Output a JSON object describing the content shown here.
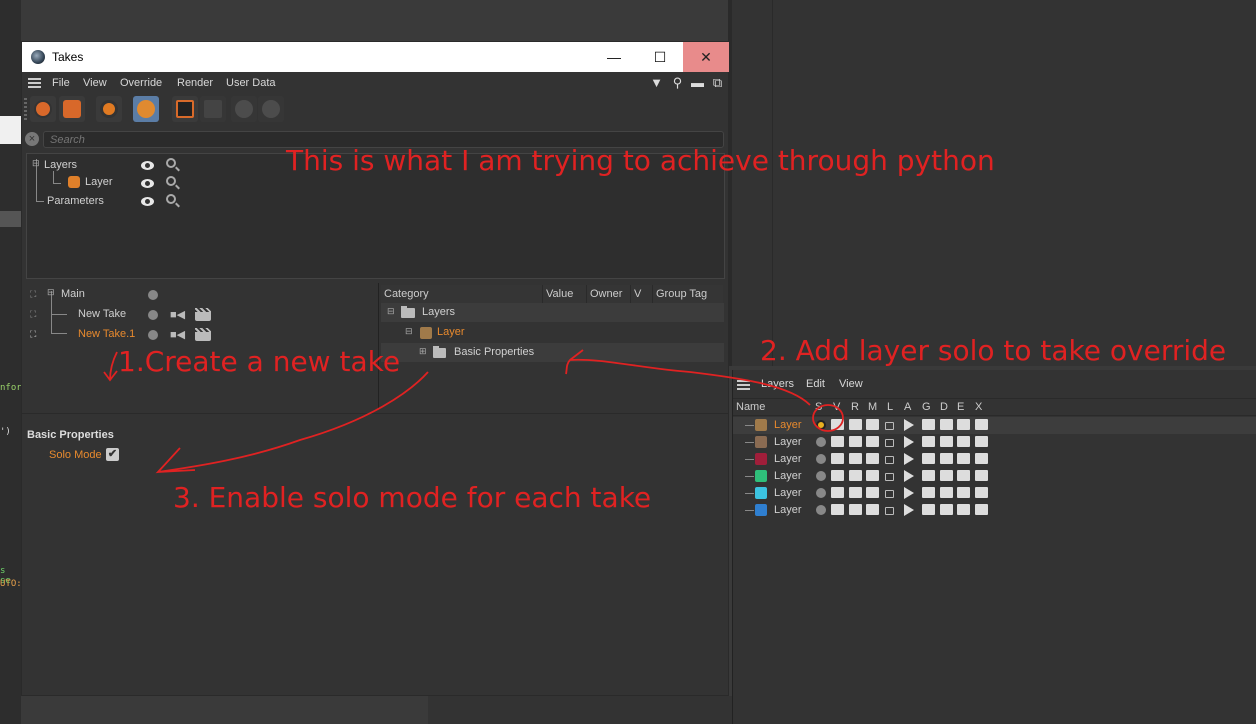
{
  "window": {
    "title": "Takes"
  },
  "window_controls": {
    "minimize": "—",
    "maximize": "☐",
    "close": "✕"
  },
  "menu": [
    "File",
    "View",
    "Override",
    "Render",
    "User Data"
  ],
  "search": {
    "placeholder": "Search"
  },
  "layers_tree": {
    "root_label": "Layers",
    "child_label": "Layer",
    "parameters_label": "Parameters"
  },
  "takes": [
    {
      "label": "Main",
      "active": false
    },
    {
      "label": "New Take",
      "active": false
    },
    {
      "label": "New Take.1",
      "active": true
    }
  ],
  "override": {
    "columns": [
      "Category",
      "Value",
      "Owner",
      "V",
      "Group Tag"
    ],
    "rows": [
      "Layers",
      "Layer",
      "Basic Properties"
    ]
  },
  "attributes": {
    "section_title": "Basic Properties",
    "solo_label": "Solo Mode",
    "solo_checked": "✔"
  },
  "layer_manager": {
    "menu": [
      "Layers",
      "Edit",
      "View"
    ],
    "columns": [
      "Name",
      "S",
      "V",
      "R",
      "M",
      "L",
      "A",
      "G",
      "D",
      "E",
      "X"
    ],
    "layers": [
      {
        "name": "Layer",
        "color": "#a07a4a",
        "solo": true
      },
      {
        "name": "Layer",
        "color": "#8a6b52",
        "solo": false
      },
      {
        "name": "Layer",
        "color": "#a01e3a",
        "solo": false
      },
      {
        "name": "Layer",
        "color": "#2fbf7a",
        "solo": false
      },
      {
        "name": "Layer",
        "color": "#3cc3e0",
        "solo": false
      },
      {
        "name": "Layer",
        "color": "#2f7fd0",
        "solo": false
      }
    ]
  },
  "annotations": {
    "headline": "This is what I am trying to achieve through python",
    "step1": "1.Create a new take",
    "step2": "2. Add layer solo to take override",
    "step3": "3. Enable solo mode for each take"
  },
  "background_code": [
    "nfor",
    "')",
    "s se",
    "UTO:"
  ],
  "colors": {
    "annotation": "#e02222",
    "active_text": "#e88a2e",
    "selected_tool": "#5b7da6"
  }
}
